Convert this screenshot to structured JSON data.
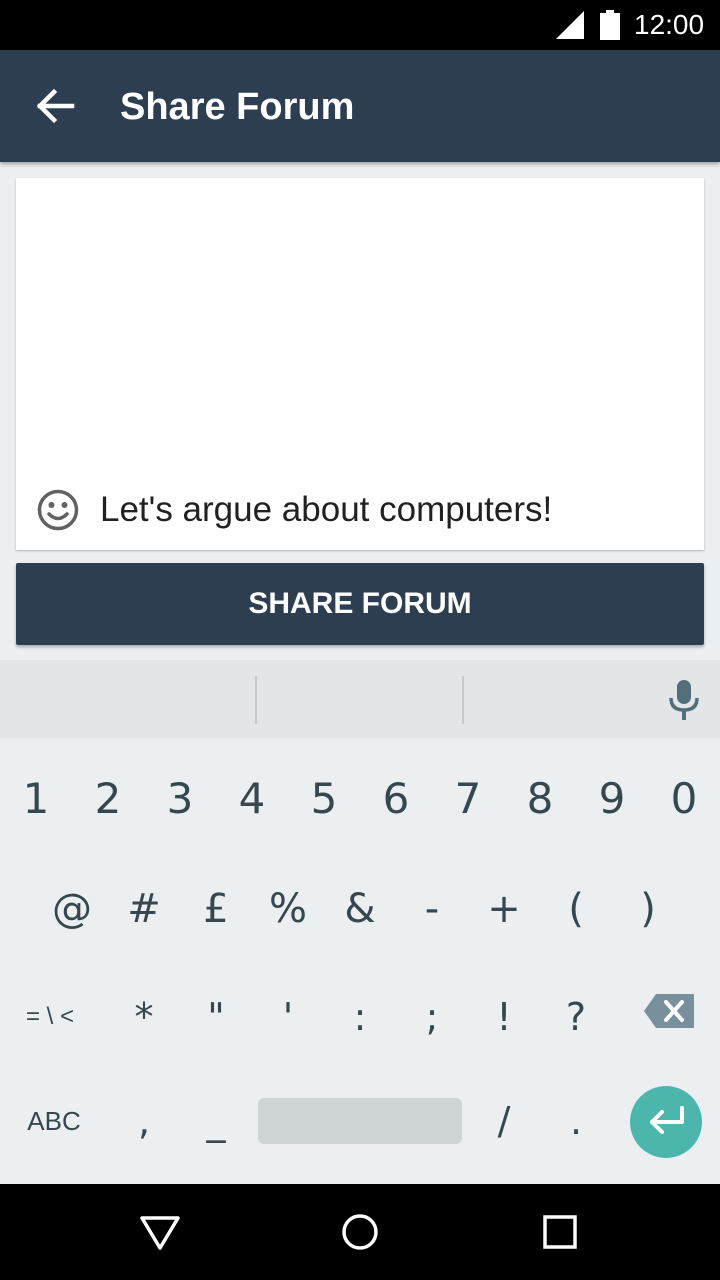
{
  "status_bar": {
    "time": "12:00"
  },
  "app_bar": {
    "title": "Share Forum"
  },
  "card": {
    "text": "Let's argue about computers!"
  },
  "share_button": {
    "label": "SHARE FORUM"
  },
  "keyboard": {
    "row1": [
      "1",
      "2",
      "3",
      "4",
      "5",
      "6",
      "7",
      "8",
      "9",
      "0"
    ],
    "row2": [
      "@",
      "#",
      "£",
      "%",
      "&",
      "-",
      "+",
      "(",
      ")"
    ],
    "row3": [
      "= \\ <",
      "*",
      "\"",
      "'",
      ":",
      ";",
      "!",
      "?"
    ],
    "row4": [
      "ABC",
      ",",
      "_",
      "/",
      "."
    ]
  },
  "colors": {
    "primary": "#2e3e51",
    "accent": "#4db6ac",
    "keyboard_bg": "#eceff1"
  },
  "icons": {
    "back": "arrow-left-icon",
    "emoji": "smiley-face-icon",
    "mic": "microphone-icon",
    "backspace": "backspace-icon",
    "enter": "enter-icon"
  }
}
